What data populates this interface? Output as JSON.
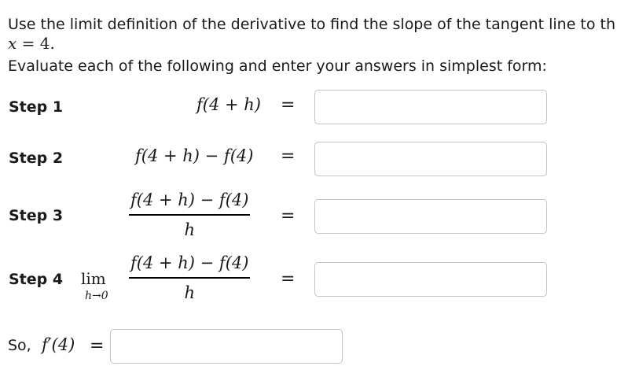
{
  "prompt": {
    "intro": "Use the limit definition of the derivative to find the slope of the tangent line to th",
    "x_var": "x",
    "x_eq": " = 4.",
    "evaluate": "Evaluate each of the following and enter your answers in simplest form:"
  },
  "steps": [
    {
      "label": "Step 1",
      "expression": "f(4 + h)",
      "equals": "=",
      "answer": ""
    },
    {
      "label": "Step 2",
      "expression": "f(4 + h) − f(4)",
      "equals": "=",
      "answer": ""
    },
    {
      "label": "Step 3",
      "numerator": "f(4 + h) − f(4)",
      "denominator": "h",
      "equals": "=",
      "answer": ""
    },
    {
      "label": "Step 4",
      "lim": "lim",
      "lim_sub": "h→0",
      "numerator": "f(4 + h) − f(4)",
      "denominator": "h",
      "equals": "=",
      "answer": ""
    }
  ],
  "final": {
    "label": "So, ",
    "expression": "f′(4)",
    "equals": "=",
    "answer": ""
  }
}
